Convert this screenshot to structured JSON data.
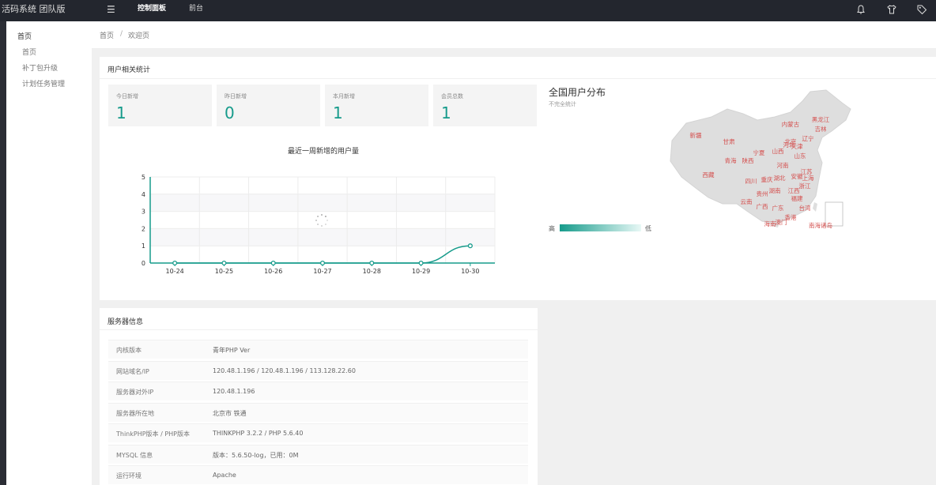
{
  "header": {
    "app_title": "活码系统 团队版",
    "nav": [
      {
        "label": "控制面板",
        "active": true
      },
      {
        "label": "前台",
        "active": false
      }
    ],
    "icons": [
      "menu-icon",
      "bell-icon",
      "shirt-icon",
      "tag-icon"
    ]
  },
  "sidebar": {
    "group_title": "首页",
    "items": [
      {
        "label": "首页"
      },
      {
        "label": "补丁包升级"
      },
      {
        "label": "计划任务管理"
      }
    ]
  },
  "breadcrumb": {
    "home": "首页",
    "separator": "/",
    "current": "欢迎页"
  },
  "user_stats": {
    "title": "用户相关统计",
    "cards": [
      {
        "label": "今日新增",
        "value": "1"
      },
      {
        "label": "昨日新增",
        "value": "0"
      },
      {
        "label": "本月新增",
        "value": "1"
      },
      {
        "label": "会员总数",
        "value": "1"
      }
    ]
  },
  "chart_data": {
    "type": "line",
    "title": "最近一周新增的用户量",
    "categories": [
      "10-24",
      "10-25",
      "10-26",
      "10-27",
      "10-28",
      "10-29",
      "10-30"
    ],
    "values": [
      0,
      0,
      0,
      0,
      0,
      0,
      1
    ],
    "y_ticks": [
      "0",
      "1",
      "2",
      "3",
      "4",
      "5"
    ],
    "ylim": [
      0,
      5
    ],
    "grid": true,
    "color": "#169b8b"
  },
  "map": {
    "title": "全国用户分布",
    "subtitle": "不完全统计",
    "legend_high": "高",
    "legend_low": "低",
    "provinces": [
      "新疆",
      "甘肃",
      "青海",
      "西藏",
      "宁夏",
      "陕西",
      "山西",
      "河北",
      "北京",
      "天津",
      "内蒙古",
      "黑龙江",
      "吉林",
      "辽宁",
      "山东",
      "河南",
      "江苏",
      "安徽",
      "上海",
      "四川",
      "重庆",
      "湖北",
      "浙江",
      "湖南",
      "江西",
      "贵州",
      "福建",
      "云南",
      "广西",
      "广东",
      "台湾",
      "香港",
      "澳门",
      "海南",
      "南海诸岛"
    ]
  },
  "server": {
    "title": "服务器信息",
    "rows": [
      {
        "key": "内核版本",
        "value": "青年PHP Ver"
      },
      {
        "key": "网站域名/IP",
        "value": "120.48.1.196 / 120.48.1.196 / 113.128.22.60"
      },
      {
        "key": "服务器对外IP",
        "value": "120.48.1.196"
      },
      {
        "key": "服务器所在地",
        "value": "北京市 铁通"
      },
      {
        "key": "ThinkPHP版本 / PHP版本",
        "value": "THINKPHP 3.2.2 / PHP 5.6.40"
      },
      {
        "key": "MYSQL 信息",
        "value": "版本：5.6.50-log，已用：0M"
      },
      {
        "key": "运行环境",
        "value": "Apache"
      }
    ]
  }
}
